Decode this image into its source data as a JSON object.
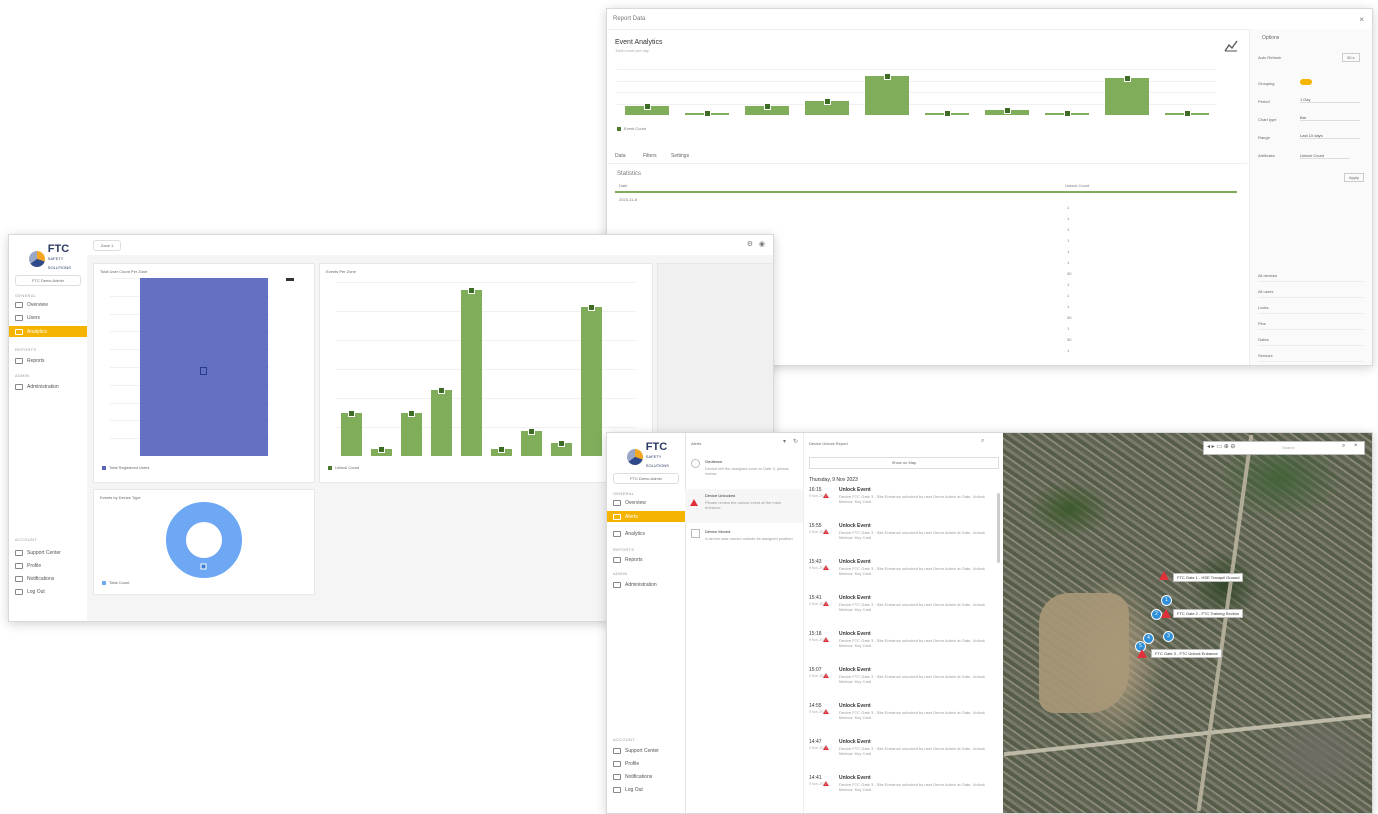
{
  "brand": {
    "name": "FTC",
    "sub": "SAFETY SOLUTIONS"
  },
  "win1": {
    "title": "Report Data",
    "chart_title": "Event Analytics",
    "chart_subtitle": "Total count per day",
    "chart_legend": "Event Count",
    "tabs": [
      "Data",
      "Filters",
      "Settings"
    ],
    "table_section": "Statistics",
    "table_head_left": "Date",
    "table_head_right": "Unlock Count",
    "table_first_row": "2023-11-8",
    "table_values": [
      "1",
      "1",
      "1",
      "1",
      "1",
      "1",
      "30",
      "1",
      "1",
      "1",
      "30",
      "1",
      "30",
      "1"
    ],
    "side": {
      "head": "Options",
      "auto_refresh": "Auto Refresh",
      "auto_refresh_btn": "30 s",
      "grouping": "Grouping",
      "rows": [
        {
          "label": "Period",
          "value": "1 Day"
        },
        {
          "label": "Chart type",
          "value": "Bar"
        },
        {
          "label": "Range",
          "value": "Last 10 days"
        }
      ],
      "extra_label": "Attributes",
      "extra_value": "Unlock Count",
      "apply": "Apply",
      "list": [
        "All devices",
        "All users",
        "Locks",
        "Pins",
        "Gates",
        "Sensors"
      ]
    }
  },
  "win2": {
    "tab_chip": "Zone 1",
    "user_chip": "FTC Demo Admin",
    "section_general": "GENERAL",
    "section_reports": "REPORTS",
    "section_admin": "ADMIN",
    "section_account": "ACCOUNT",
    "nav": [
      "Overview",
      "Users",
      "Analytics"
    ],
    "nav_reports": "Reports",
    "nav_admin": "Administration",
    "nav_bottom": [
      "Support Center",
      "Profile",
      "Notifications",
      "Log Out"
    ],
    "panel1_title": "Total User Count Per Zone",
    "panel1_value": "1",
    "panel1_legend": "Total Registered Users",
    "panel2_title": "Events Per Zone",
    "panel2_legend": "Unlock Count",
    "panel3_title": "Events by Device Type",
    "panel3_legend": "Total Count"
  },
  "win3": {
    "user_chip": "FTC Demo Admin",
    "section_general": "GENERAL",
    "section_reports": "REPORTS",
    "section_admin": "ADMIN",
    "section_account": "ACCOUNT",
    "nav": [
      "Overview",
      "Alerts",
      "Analytics"
    ],
    "nav_reports": "Reports",
    "nav_admin": "Administration",
    "nav_bottom": [
      "Support Center",
      "Profile",
      "Notifications",
      "Log Out"
    ],
    "list_head": "Alerts",
    "list_items": [
      {
        "title": "Geofence",
        "desc": "Device left the assigned zone at Gate 3, please review"
      },
      {
        "title": "Device Unlocked",
        "desc": "Please review the unlock event at the main entrance"
      },
      {
        "title": "Device Moved",
        "desc": "A device was moved outside its assigned position"
      }
    ],
    "detail_head": "Device Unlock Report",
    "detail_btn": "Show on Map",
    "detail_date": "Thursday, 9 Nov 2023",
    "events": [
      {
        "time": "16:15",
        "date": "9 Nov 2023",
        "title": "Unlock Event",
        "desc": "Device FTC Gate 3 - Site Entrance unlocked by user Demo Admin at Gate, Unlock Method: Key Card"
      },
      {
        "time": "15:55",
        "date": "9 Nov 2023",
        "title": "Unlock Event",
        "desc": "Device FTC Gate 3 - Site Entrance unlocked by user Demo Admin at Gate, Unlock Method: Key Card"
      },
      {
        "time": "15:43",
        "date": "9 Nov 2023",
        "title": "Unlock Event",
        "desc": "Device FTC Gate 3 - Site Entrance unlocked by user Demo Admin at Gate, Unlock Method: Key Card"
      },
      {
        "time": "15:41",
        "date": "9 Nov 2023",
        "title": "Unlock Event",
        "desc": "Device FTC Gate 3 - Site Entrance unlocked by user Demo Admin at Gate, Unlock Method: Key Card"
      },
      {
        "time": "15:18",
        "date": "9 Nov 2023",
        "title": "Unlock Event",
        "desc": "Device FTC Gate 3 - Site Entrance unlocked by user Demo Admin at Gate, Unlock Method: Key Card"
      },
      {
        "time": "15:07",
        "date": "9 Nov 2023",
        "title": "Unlock Event",
        "desc": "Device FTC Gate 3 - Site Entrance unlocked by user Demo Admin at Gate, Unlock Method: Key Card"
      },
      {
        "time": "14:55",
        "date": "9 Nov 2023",
        "title": "Unlock Event",
        "desc": "Device FTC Gate 3 - Site Entrance unlocked by user Demo Admin at Gate, Unlock Method: Key Card"
      },
      {
        "time": "14:47",
        "date": "9 Nov 2023",
        "title": "Unlock Event",
        "desc": "Device FTC Gate 3 - Site Entrance unlocked by user Demo Admin at Gate, Unlock Method: Key Card"
      },
      {
        "time": "14:41",
        "date": "9 Nov 2023",
        "title": "Unlock Event",
        "desc": "Device FTC Gate 3 - Site Entrance unlocked by user Demo Admin at Gate, Unlock Method: Key Card"
      }
    ],
    "map_search": "Search",
    "map_labels": [
      "FTC Gate 1 - HSE Tranquil Ground",
      "FTC Gate 2 - FTC Training Section",
      "FTC Gate 3 - FTC Unlock Entrance"
    ],
    "pins": [
      "1",
      "2",
      "3",
      "4",
      "5"
    ]
  },
  "chart_data": [
    {
      "type": "bar",
      "title": "",
      "categories": [
        "",
        "",
        "",
        "",
        "",
        "",
        "",
        "",
        "",
        "",
        ""
      ],
      "series": [
        {
          "values": [
            2,
            0.3,
            2,
            3,
            8.5,
            0.3,
            1,
            0.5,
            8,
            0.5
          ]
        }
      ],
      "ylim": [
        0,
        10
      ]
    },
    {
      "type": "bar",
      "categories": [
        ""
      ],
      "values": [
        1
      ],
      "ylim": [
        0,
        1
      ]
    },
    {
      "type": "bar",
      "values": [
        26,
        4,
        26,
        40,
        100,
        4,
        15,
        8,
        90,
        0
      ],
      "ylim": [
        0,
        100
      ]
    },
    {
      "type": "pie",
      "values": [
        1
      ]
    }
  ]
}
